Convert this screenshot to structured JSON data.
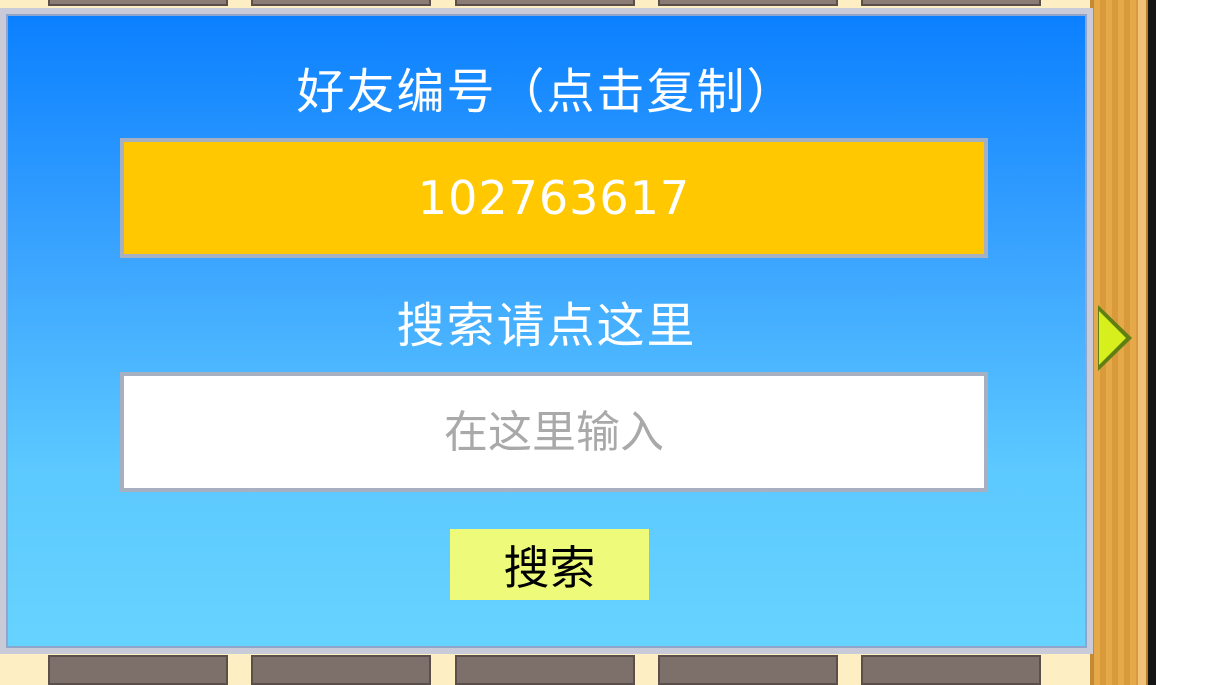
{
  "dialog": {
    "title": "好友编号（点击复制）",
    "friend_id": "102763617",
    "search_label": "搜索请点这里",
    "search_placeholder": "在这里输入",
    "search_button_label": "搜索"
  },
  "colors": {
    "dialog_top": "#0b80ff",
    "dialog_bottom": "#66d3ff",
    "id_box": "#ffc800",
    "search_button": "#eefb7a",
    "arrow": "#d7ef1c"
  },
  "icons": {
    "side_arrow": "arrow-right-icon"
  }
}
